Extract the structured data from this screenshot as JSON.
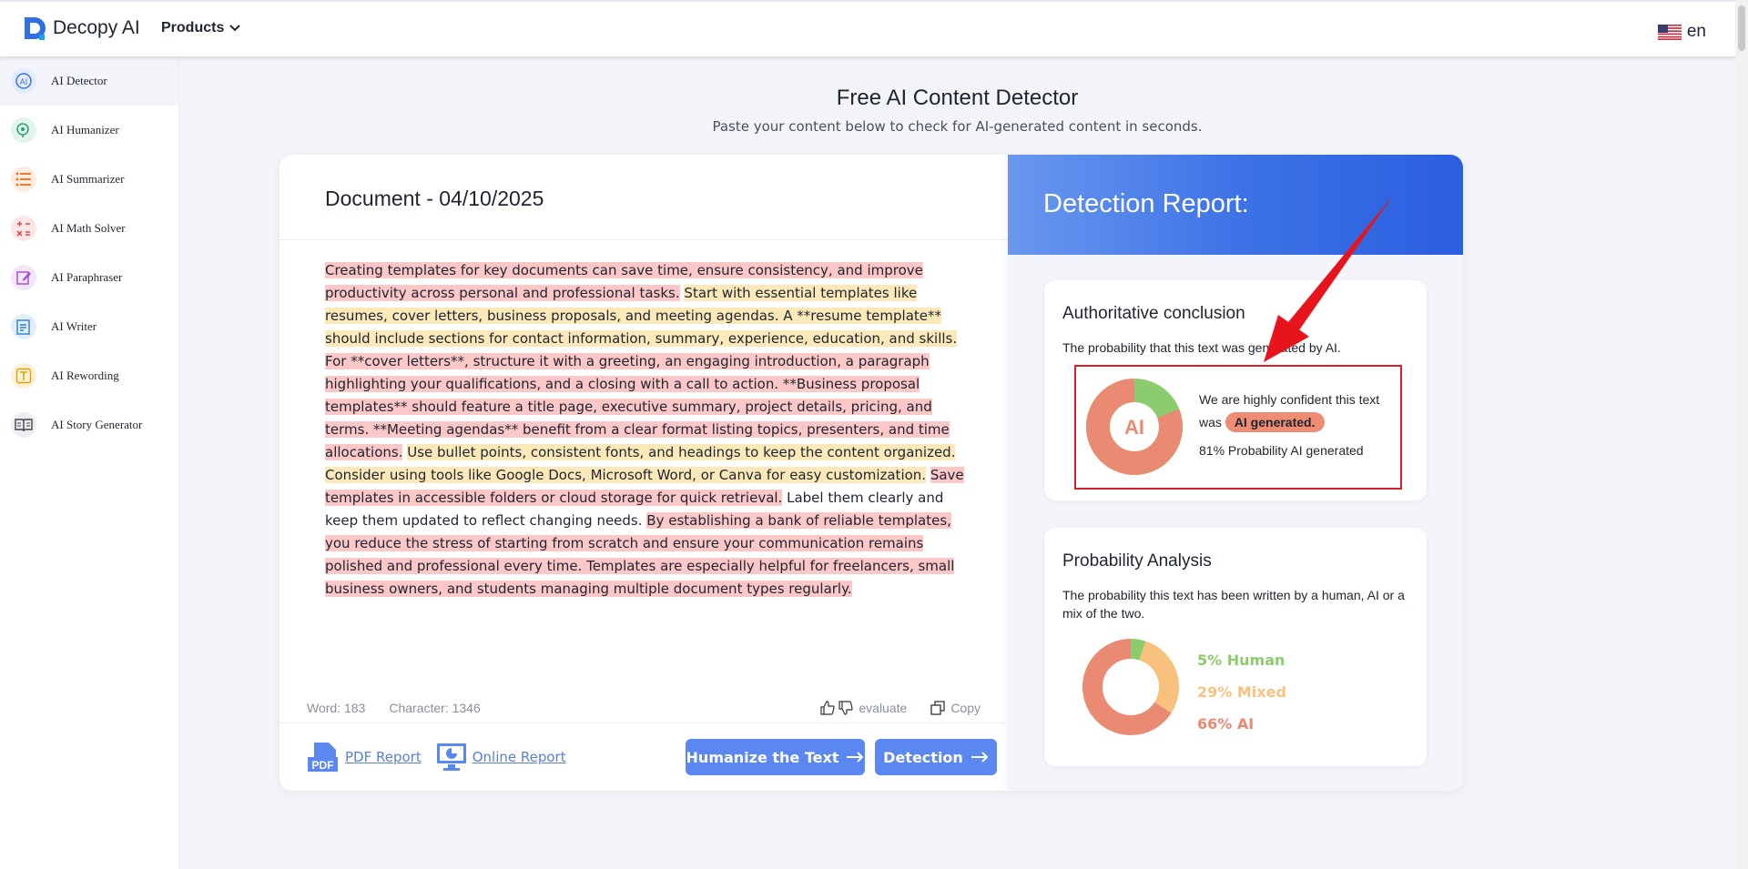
{
  "brand": {
    "name": "Decopy AI",
    "products_label": "Products"
  },
  "lang": {
    "code": "en"
  },
  "sidebar": {
    "items": [
      {
        "label": "AI Detector",
        "icon": "ai-detector-icon",
        "active": true
      },
      {
        "label": "AI Humanizer",
        "icon": "humanizer-icon"
      },
      {
        "label": "AI Summarizer",
        "icon": "list-icon"
      },
      {
        "label": "AI Math Solver",
        "icon": "math-icon"
      },
      {
        "label": "AI Paraphraser",
        "icon": "pencil-icon"
      },
      {
        "label": "AI Writer",
        "icon": "writer-icon"
      },
      {
        "label": "AI Rewording",
        "icon": "text-icon"
      },
      {
        "label": "AI Story Generator",
        "icon": "book-icon"
      }
    ]
  },
  "hero": {
    "title": "Free AI Content Detector",
    "subtitle": "Paste your content below to check for AI-generated content in seconds."
  },
  "document": {
    "title": "Document - 04/10/2025",
    "segments": [
      {
        "text": "Creating templates for key documents can save time, ensure consistency, and improve productivity across personal and professional tasks.",
        "hl": "red"
      },
      {
        "text": " ",
        "hl": "none"
      },
      {
        "text": "Start with essential templates like resumes, cover letters, business proposals, and meeting agendas. A **resume template** should include sections for contact information, summary, experience, education, and skills.",
        "hl": "yellow"
      },
      {
        "text": " ",
        "hl": "none"
      },
      {
        "text": "For **cover letters**, structure it with a greeting, an engaging introduction, a paragraph highlighting your qualifications, and a closing with a call to action. **Business proposal templates** should feature a title page, executive summary, project details, pricing, and terms. **Meeting agendas** benefit from a clear format listing topics, presenters, and time allocations.",
        "hl": "red"
      },
      {
        "text": " ",
        "hl": "none"
      },
      {
        "text": "Use bullet points, consistent fonts, and headings to keep the content organized. Consider using tools like Google Docs, Microsoft Word, or Canva for easy customization.",
        "hl": "yellow"
      },
      {
        "text": " ",
        "hl": "none"
      },
      {
        "text": "Save templates in accessible folders or cloud storage for quick retrieval.",
        "hl": "red"
      },
      {
        "text": " Label them clearly and keep them updated to reflect changing needs. ",
        "hl": "none"
      },
      {
        "text": "By establishing a bank of reliable templates, you reduce the stress of starting from scratch and ensure your communication remains polished and professional every time. Templates are especially helpful for freelancers, small business owners, and students managing multiple document types regularly.",
        "hl": "red"
      }
    ],
    "word_label": "Word: 183",
    "char_label": "Character: 1346",
    "evaluate_label": "evaluate",
    "copy_label": "Copy",
    "pdf_report_label": "PDF Report",
    "online_report_label": "Online Report",
    "humanize_label": "Humanize the Text",
    "detection_label": "Detection"
  },
  "report": {
    "title": "Detection Report:",
    "conclusion": {
      "heading": "Authoritative conclusion",
      "sub": "The probability that this text was generated by AI.",
      "donut_label": "AI",
      "confident_text": "We are highly confident this text was",
      "badge": "AI generated.",
      "probability_text": "81% Probability AI generated",
      "ai_fraction": 0.81
    },
    "analysis": {
      "heading": "Probability Analysis",
      "sub": "The probability this text has been written by a human, AI or a mix of the two.",
      "human": {
        "label": "5% Human",
        "pct": 5
      },
      "mixed": {
        "label": "29% Mixed",
        "pct": 29
      },
      "ai": {
        "label": "66% AI",
        "pct": 66
      }
    }
  },
  "colors": {
    "accent": "#5b87f0",
    "human": "#8ccb6e",
    "mixed": "#f8c27e",
    "ai": "#eb8a72",
    "highlight_red": "#fbc7c7",
    "highlight_yellow": "#fbe9b9"
  }
}
